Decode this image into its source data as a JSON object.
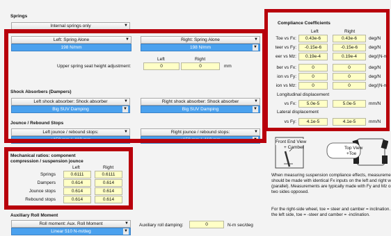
{
  "springs": {
    "title": "Springs",
    "mode": "Internal springs only",
    "left_spring": "Left: Spring Alone",
    "right_spring": "Right: Spring Alone",
    "left_value": "198 N/mm",
    "right_value": "198 N/mm",
    "col_left": "Left",
    "col_right": "Right",
    "seat_label": "Upper spring seat height adjustment:",
    "seat_left": "0",
    "seat_right": "0",
    "seat_unit": "mm"
  },
  "shocks": {
    "title": "Shock Absorbers (Dampers)",
    "left_type": "Left shock absorber: Shock absorber",
    "right_type": "Right shock absorber: Shock absorber",
    "left_value": "Big SUV Damping",
    "right_value": "Big SUV Damping"
  },
  "stops": {
    "title": "Jounce / Rebound Stops",
    "left_type": "Left jounce / rebound stops:",
    "right_type": "Right jounce / rebound stops:",
    "left_value": "+150 mm / -110 mm",
    "right_value": "+150 mm / -110 mm"
  },
  "mech": {
    "title1": "Mechanical ratios: component",
    "title2": "compression / suspension jounce",
    "col_left": "Left",
    "col_right": "Right",
    "rows": [
      {
        "label": "Springs",
        "left": "0.6111",
        "right": "0.6111"
      },
      {
        "label": "Dampers",
        "left": "0.614",
        "right": "0.614"
      },
      {
        "label": "Jounce stops",
        "left": "0.614",
        "right": "0.614"
      },
      {
        "label": "Rebound stops",
        "left": "0.614",
        "right": "0.614"
      }
    ]
  },
  "aux": {
    "title": "Auxiliary Roll Moment",
    "type": "Roll moment: Aux. Roll Moment",
    "value": "Linear 510 N-m/deg",
    "damping_label": "Auxiliary roll damping:",
    "damping_value": "0",
    "damping_unit": "N-m sec/deg"
  },
  "compliance": {
    "title": "Compliance Coefficients",
    "col_left": "Left",
    "col_right": "Right",
    "rows": [
      {
        "label": "Toe vs Fx:",
        "left": "0.43e-6",
        "right": "0.43e-6",
        "unit": "deg/N"
      },
      {
        "label": "teer vs Fy:",
        "left": "-0.15e-6",
        "right": "-0.15e-6",
        "unit": "deg/N"
      },
      {
        "label": "eer vs Mz:",
        "left": "0.19e-4",
        "right": "0.19e-4",
        "unit": "deg/(N-m"
      },
      {
        "label": "ber vs Fx:",
        "left": "0",
        "right": "0",
        "unit": "deg/N"
      },
      {
        "label": "ion vs Fy:",
        "left": "0",
        "right": "0",
        "unit": "deg/N"
      },
      {
        "label": "ion vs Mz:",
        "left": "0",
        "right": "0",
        "unit": "deg/(N-m"
      }
    ],
    "long_title": "Longitudinal displacement",
    "long_row": {
      "label": "vs Fx:",
      "left": "5.0e-5",
      "right": "5.0e-5",
      "unit": "mm/N"
    },
    "lat_title": "Lateral displacement",
    "lat_row": {
      "label": "vs Fy:",
      "left": "4.1e-5",
      "right": "4.1e-5",
      "unit": "mm/N"
    }
  },
  "diagram": {
    "front_label": "Front End View",
    "front_sub": "+ Camber",
    "top_label": "Top View",
    "top_sub": "+Toe"
  },
  "notes": {
    "p1": "When measuring suspension compliance effects, measurements should be made with identical Fx inputs on the left and right wheels (parallel). Measurements are typically made with Fy and Mz on the two sides opposed.",
    "p2": "For the right-side wheel, toe = steer and camber = inclination. For the left side, toe = -steer and camber = -inclination."
  },
  "colors": {
    "highlight_border": "#b8000c",
    "dropdown_selected": "#4aa1ee",
    "input_bg": "#ffffc6"
  }
}
